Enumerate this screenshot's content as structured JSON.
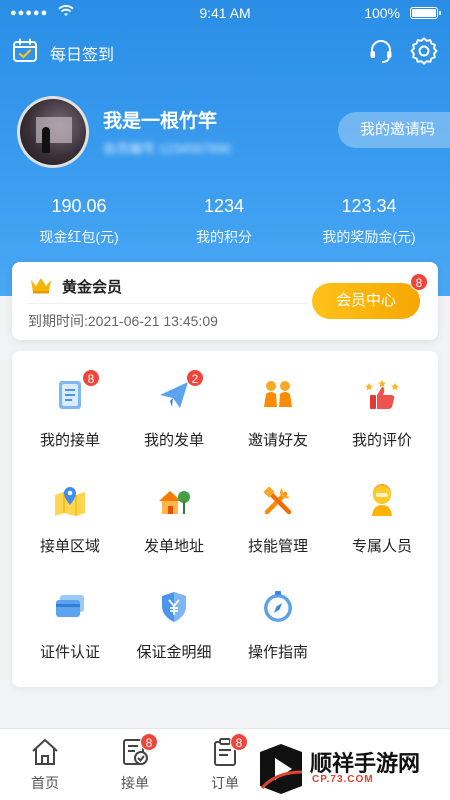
{
  "status_bar": {
    "signal": "●●●●●",
    "time": "9:41 AM",
    "battery": "100%"
  },
  "header": {
    "checkin_label": "每日签到"
  },
  "profile": {
    "name": "我是一根竹竿",
    "subtitle": "会员编号 1234567890",
    "invite_label": "我的邀请码"
  },
  "stats": [
    {
      "value": "190.06",
      "label": "现金红包(元)"
    },
    {
      "value": "1234",
      "label": "我的积分"
    },
    {
      "value": "123.34",
      "label": "我的奖励金(元)"
    }
  ],
  "membership": {
    "title": "黄金会员",
    "expiry": "到期时间:2021-06-21 13:45:09",
    "center_label": "会员中心",
    "center_badge": "8"
  },
  "grid": [
    {
      "label": "我的接单",
      "icon": "clipboard-list-icon",
      "badge": "8"
    },
    {
      "label": "我的发单",
      "icon": "paper-plane-icon",
      "badge": "2"
    },
    {
      "label": "邀请好友",
      "icon": "friends-icon",
      "badge": ""
    },
    {
      "label": "我的评价",
      "icon": "thumbs-up-stars-icon",
      "badge": ""
    },
    {
      "label": "接单区域",
      "icon": "map-pin-icon",
      "badge": ""
    },
    {
      "label": "发单地址",
      "icon": "house-tree-icon",
      "badge": ""
    },
    {
      "label": "技能管理",
      "icon": "tools-icon",
      "badge": ""
    },
    {
      "label": "专属人员",
      "icon": "staff-person-icon",
      "badge": ""
    },
    {
      "label": "证件认证",
      "icon": "id-card-icon",
      "badge": ""
    },
    {
      "label": "保证金明细",
      "icon": "shield-yen-icon",
      "badge": ""
    },
    {
      "label": "操作指南",
      "icon": "compass-icon",
      "badge": ""
    }
  ],
  "tabbar": [
    {
      "label": "首页",
      "icon": "home-icon",
      "badge": ""
    },
    {
      "label": "接单",
      "icon": "order-check-icon",
      "badge": "8"
    },
    {
      "label": "订单",
      "icon": "clipboard-icon",
      "badge": "8"
    }
  ],
  "watermark": {
    "text": "顺祥手游网",
    "url": "CP.73.COM"
  },
  "colors": {
    "primary": "#2a8ee6",
    "accent_gold": "#f5a700",
    "badge_red": "#f0453a"
  }
}
